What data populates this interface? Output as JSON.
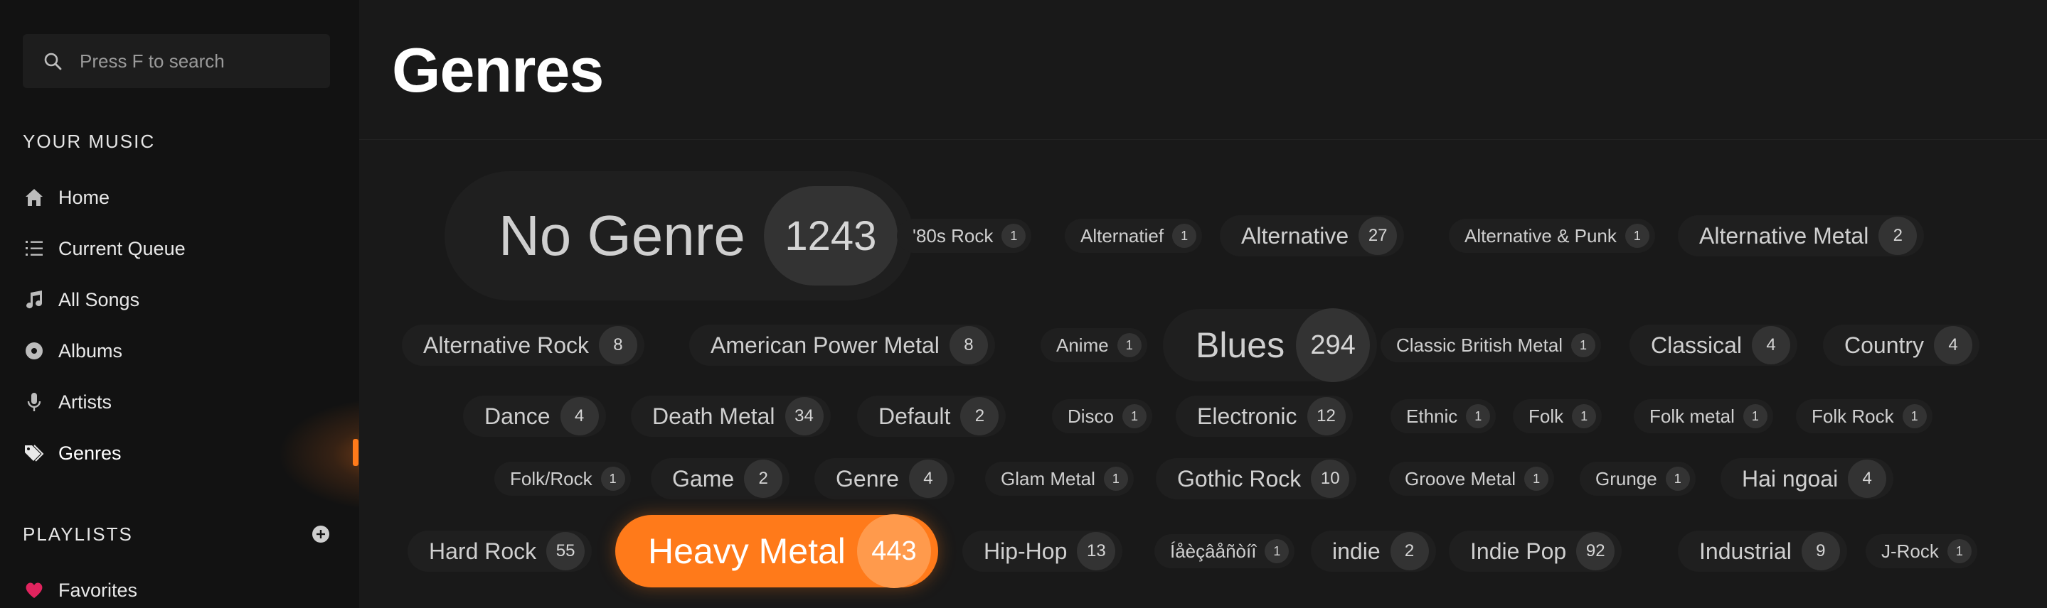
{
  "search": {
    "placeholder": "Press F to search"
  },
  "sidebar": {
    "your_music_title": "YOUR MUSIC",
    "items": [
      {
        "label": "Home",
        "icon": "home-icon"
      },
      {
        "label": "Current Queue",
        "icon": "queue-icon"
      },
      {
        "label": "All Songs",
        "icon": "music-note-icon"
      },
      {
        "label": "Albums",
        "icon": "album-icon"
      },
      {
        "label": "Artists",
        "icon": "microphone-icon"
      },
      {
        "label": "Genres",
        "icon": "tag-icon",
        "active": true
      }
    ],
    "playlists_title": "PLAYLISTS",
    "playlists": [
      {
        "label": "Favorites",
        "icon": "heart-icon"
      }
    ]
  },
  "main": {
    "title": "Genres"
  },
  "colors": {
    "accent": "#ff7a1a",
    "favorite": "#e0245e"
  },
  "genres": [
    {
      "name": "No Genre",
      "count": "1243"
    },
    {
      "name": "'80s Rock",
      "count": "1"
    },
    {
      "name": "Alternatief",
      "count": "1"
    },
    {
      "name": "Alternative",
      "count": "27"
    },
    {
      "name": "Alternative & Punk",
      "count": "1"
    },
    {
      "name": "Alternative Metal",
      "count": "2"
    },
    {
      "name": "Alternative Rock",
      "count": "8"
    },
    {
      "name": "American Power Metal",
      "count": "8"
    },
    {
      "name": "Anime",
      "count": "1"
    },
    {
      "name": "Blues",
      "count": "294"
    },
    {
      "name": "Classic British Metal",
      "count": "1"
    },
    {
      "name": "Classical",
      "count": "4"
    },
    {
      "name": "Country",
      "count": "4"
    },
    {
      "name": "Dance",
      "count": "4"
    },
    {
      "name": "Death Metal",
      "count": "34"
    },
    {
      "name": "Default",
      "count": "2"
    },
    {
      "name": "Disco",
      "count": "1"
    },
    {
      "name": "Electronic",
      "count": "12"
    },
    {
      "name": "Ethnic",
      "count": "1"
    },
    {
      "name": "Folk",
      "count": "1"
    },
    {
      "name": "Folk metal",
      "count": "1"
    },
    {
      "name": "Folk Rock",
      "count": "1"
    },
    {
      "name": "Folk/Rock",
      "count": "1"
    },
    {
      "name": "Game",
      "count": "2"
    },
    {
      "name": "Genre",
      "count": "4"
    },
    {
      "name": "Glam Metal",
      "count": "1"
    },
    {
      "name": "Gothic Rock",
      "count": "10"
    },
    {
      "name": "Groove Metal",
      "count": "1"
    },
    {
      "name": "Grunge",
      "count": "1"
    },
    {
      "name": "Hai ngoai",
      "count": "4"
    },
    {
      "name": "Hard Rock",
      "count": "55"
    },
    {
      "name": "Heavy Metal",
      "count": "443",
      "highlighted": true
    },
    {
      "name": "Hip-Hop",
      "count": "13"
    },
    {
      "name": "Íåèçâåñòíî",
      "count": "1"
    },
    {
      "name": "indie",
      "count": "2"
    },
    {
      "name": "Indie Pop",
      "count": "92"
    },
    {
      "name": "Industrial",
      "count": "9"
    },
    {
      "name": "J-Rock",
      "count": "1"
    }
  ]
}
